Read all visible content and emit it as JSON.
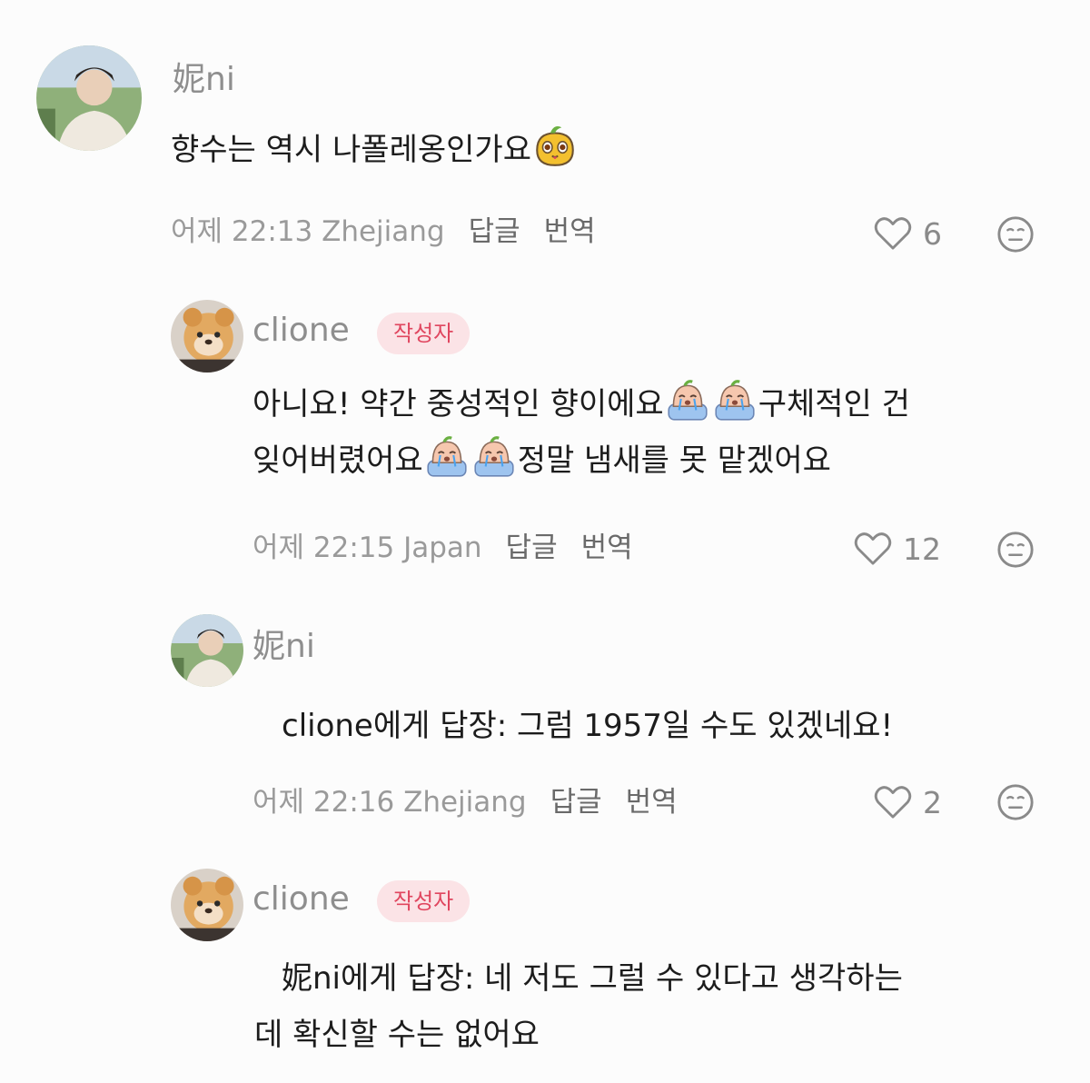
{
  "comments": [
    {
      "username": "妮ni",
      "text_before": "향수는 역시 나폴레옹인가요",
      "meta_time_location": "어제 22:13 Zhejiang",
      "reply_label": "답글",
      "translate_label": "번역",
      "likes": "6",
      "emoji": "mango-face"
    },
    {
      "username": "clione",
      "badge": "작성자",
      "line1_a": "아니요! 약간 중성적인 향이에요",
      "line1_b": "구체적인 건",
      "line2_a": "잊어버렸어요",
      "line2_b": "정말 냄새를 못 맡겠어요",
      "meta_time_location": "어제 22:15 Japan",
      "reply_label": "답글",
      "translate_label": "번역",
      "likes": "12",
      "emoji": "crying-peach"
    },
    {
      "username": "妮ni",
      "text": "clione에게 답장: 그럼 1957일 수도 있겠네요!",
      "meta_time_location": "어제 22:16 Zhejiang",
      "reply_label": "답글",
      "translate_label": "번역",
      "likes": "2"
    },
    {
      "username": "clione",
      "badge": "작성자",
      "line1": "妮ni에게 답장: 네 저도 그럴 수 있다고 생각하는",
      "line2": "데 확신할 수는 없어요"
    }
  ],
  "icons": {
    "like": "heart-outline-icon",
    "react": "neutral-face-icon"
  },
  "colors": {
    "background": "#fcfcfc",
    "badge_bg": "#fbe3e6",
    "badge_text": "#e0465f",
    "meta_text": "#9a9a9a"
  }
}
